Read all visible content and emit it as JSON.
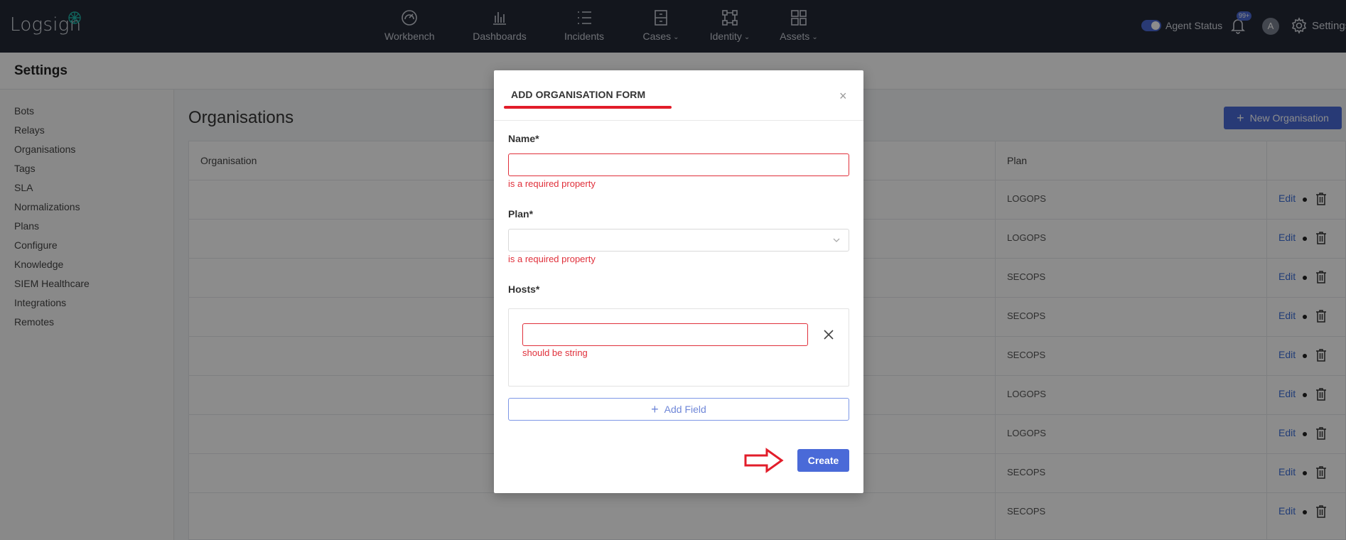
{
  "app": {
    "logo_text": "Logsign",
    "nav": [
      {
        "label": "Workbench",
        "icon": "speedometer-icon"
      },
      {
        "label": "Dashboards",
        "icon": "bar-chart-icon"
      },
      {
        "label": "Incidents",
        "icon": "list-icon"
      },
      {
        "label": "Cases",
        "icon": "cabinet-icon",
        "dropdown": true
      },
      {
        "label": "Identity",
        "icon": "network-icon",
        "dropdown": true
      },
      {
        "label": "Assets",
        "icon": "layout-icon",
        "dropdown": true
      }
    ],
    "agent_status_label": "Agent Status",
    "notification_badge": "99+",
    "avatar_initial": "A",
    "settings_label": "Settings",
    "accent_color": "#4a6ad8"
  },
  "page": {
    "title": "Settings"
  },
  "sidebar": {
    "items": [
      "Bots",
      "Relays",
      "Organisations",
      "Tags",
      "SLA",
      "Normalizations",
      "Plans",
      "Configure",
      "Knowledge",
      "SIEM Healthcare",
      "Integrations",
      "Remotes"
    ]
  },
  "main": {
    "section_title": "Organisations",
    "new_button_label": "New Organisation",
    "columns": [
      "Organisation",
      "Plan"
    ],
    "edit_label": "Edit",
    "rows": [
      {
        "plan": "LOGOPS"
      },
      {
        "plan": "LOGOPS"
      },
      {
        "plan": "SECOPS"
      },
      {
        "plan": "SECOPS"
      },
      {
        "plan": "SECOPS"
      },
      {
        "plan": "LOGOPS"
      },
      {
        "plan": "LOGOPS"
      },
      {
        "plan": "SECOPS"
      },
      {
        "plan": "SECOPS"
      }
    ]
  },
  "modal": {
    "title": "ADD ORGANISATION FORM",
    "name_label": "Name*",
    "name_value": "",
    "name_error": "is a required property",
    "plan_label": "Plan*",
    "plan_value": "",
    "plan_error": "is a required property",
    "hosts_label": "Hosts*",
    "host_value": "",
    "host_error": "should be string",
    "add_field_label": "Add Field",
    "create_label": "Create",
    "error_color": "#e0303b"
  }
}
